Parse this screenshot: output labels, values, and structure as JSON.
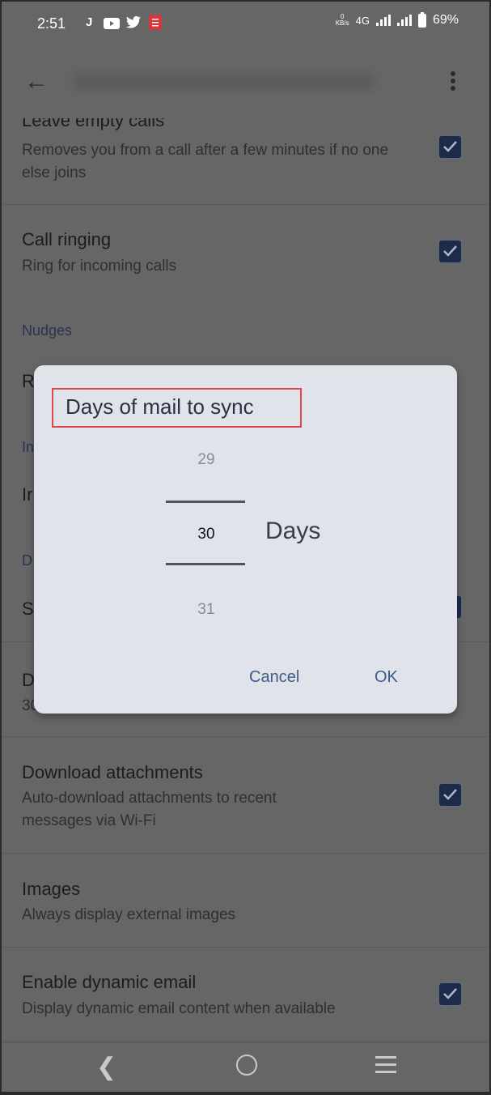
{
  "status_bar": {
    "time": "2:51",
    "notification_icons": [
      "jio-icon",
      "youtube-icon",
      "twitter-icon",
      "document-icon"
    ],
    "notification_glyph_j": "J",
    "net_speed_value": "0",
    "net_speed_unit": "KB/s",
    "network": "4G",
    "battery": "69%"
  },
  "app_bar": {
    "back_icon": "arrow-left-icon",
    "account_email_blurred": "priyanka0219@gmail.com",
    "menu_icon": "more-vertical-icon"
  },
  "settings": {
    "leave_empty_calls": {
      "title": "Leave empty calls",
      "subtitle": "Removes you from a call after a few minutes if no one else joins",
      "checked": true
    },
    "call_ringing": {
      "title": "Call ringing",
      "subtitle": "Ring for incoming calls",
      "checked": true
    },
    "nudges_section": "Nudges",
    "obscured": {
      "nudges_item_initial": "R",
      "inbox_section_initial": "In",
      "inbox_item_initial": "Ir",
      "data_section_initial": "D",
      "sync_item_initial": "S",
      "days_item_initial": "D",
      "days_item_sub_initial": "30"
    },
    "download_attachments": {
      "title": "Download attachments",
      "subtitle": "Auto-download attachments to recent messages via Wi-Fi",
      "checked": true
    },
    "images": {
      "title": "Images",
      "subtitle": "Always display external images"
    },
    "dynamic_email": {
      "title": "Enable dynamic email",
      "subtitle": "Display dynamic email content when available",
      "checked": true
    }
  },
  "dialog": {
    "title": "Days of mail to sync",
    "picker": {
      "previous": "29",
      "selected": "30",
      "next": "31",
      "unit": "Days"
    },
    "cancel_label": "Cancel",
    "ok_label": "OK",
    "highlight_color": "#e0474c"
  },
  "nav_bar": {
    "back": "back-icon",
    "home": "home-icon",
    "recents": "recents-icon"
  }
}
